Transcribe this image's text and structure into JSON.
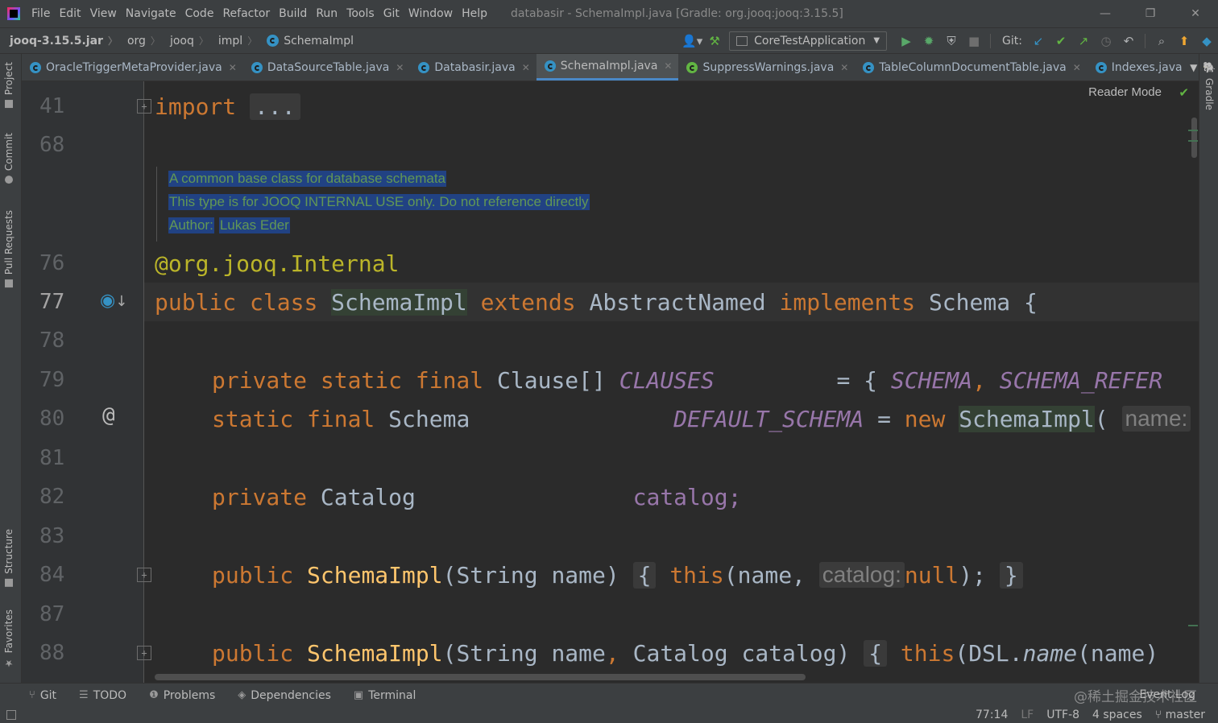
{
  "menubar": {
    "items": [
      "File",
      "Edit",
      "View",
      "Navigate",
      "Code",
      "Refactor",
      "Build",
      "Run",
      "Tools",
      "Git",
      "Window",
      "Help"
    ],
    "window_title": "databasir - SchemaImpl.java [Gradle: org.jooq:jooq:3.15.5]"
  },
  "navbar": {
    "breadcrumbs": [
      "jooq-3.15.5.jar",
      "org",
      "jooq",
      "impl",
      "SchemaImpl"
    ],
    "run_config": "CoreTestApplication",
    "git_label": "Git:"
  },
  "left_tools": [
    "Project",
    "Commit",
    "Pull Requests",
    "Structure",
    "Favorites"
  ],
  "right_tools": [
    "Gradle"
  ],
  "tabs": [
    {
      "label": "OracleTriggerMetaProvider.java",
      "active": false
    },
    {
      "label": "DataSourceTable.java",
      "active": false
    },
    {
      "label": "Databasir.java",
      "active": false
    },
    {
      "label": "SchemaImpl.java",
      "active": true
    },
    {
      "label": "SuppressWarnings.java",
      "active": false
    },
    {
      "label": "TableColumnDocumentTable.java",
      "active": false
    },
    {
      "label": "Indexes.java",
      "active": false
    }
  ],
  "editor": {
    "reader_mode": "Reader Mode",
    "line_numbers": [
      "41",
      "68",
      "76",
      "77",
      "78",
      "79",
      "80",
      "81",
      "82",
      "83",
      "84",
      "87",
      "88"
    ],
    "doc": {
      "line1": "A common base class for database schemata",
      "line2": "This type is for JOOQ INTERNAL USE only. Do not reference directly",
      "author_label": "Author:",
      "author_name": "Lukas Eder"
    },
    "code": {
      "l41_kw": "import",
      "l41_fold": "...",
      "l76": "@org.jooq.Internal",
      "l77_public": "public",
      "l77_class": "class",
      "l77_name": "SchemaImpl",
      "l77_extends": "extends",
      "l77_base": "AbstractNamed",
      "l77_implements": "implements",
      "l77_iface": "Schema {",
      "l79_mods": "private static final",
      "l79_type": "Clause[]",
      "l79_name": "CLAUSES",
      "l79_eq": "= {",
      "l79_v1": "SCHEMA",
      "l79_comma": ",",
      "l79_v2": "SCHEMA_REFER",
      "l80_mods": "static final",
      "l80_type": "Schema",
      "l80_name": "DEFAULT_SCHEMA",
      "l80_eq": "=",
      "l80_new": "new",
      "l80_ctor": "SchemaImpl",
      "l80_paren": "(",
      "l80_hint": "name:",
      "l80_str": "\"\"",
      "l82_mods": "private",
      "l82_type": "Catalog",
      "l82_name": "catalog;",
      "l84_public": "public",
      "l84_ctor": "SchemaImpl",
      "l84_params": "(String name)",
      "l84_open": "{",
      "l84_this": "this",
      "l84_args": "(name,",
      "l84_hint": "catalog:",
      "l84_null": "null",
      "l84_end": ");",
      "l84_close": "}",
      "l88_public": "public",
      "l88_ctor": "SchemaImpl",
      "l88_p1": "(String name",
      "l88_comma": ",",
      "l88_p2": "Catalog catalog)",
      "l88_open": "{",
      "l88_this": "this",
      "l88_call1": "(DSL.",
      "l88_call2": "name",
      "l88_call3": "(name)"
    }
  },
  "bottom_tools": [
    "Git",
    "TODO",
    "Problems",
    "Dependencies",
    "Terminal"
  ],
  "event_log": "Event Log",
  "watermark": "@稀土掘金技术社区",
  "statusbar": {
    "position": "77:14",
    "line_sep": "LF",
    "encoding": "UTF-8",
    "indent": "4 spaces",
    "branch": "master"
  },
  "colors": {
    "keyword": "#cc7832",
    "annotation": "#bbb529",
    "constant": "#9876aa",
    "function": "#ffc66d",
    "doc_highlight": "#214283",
    "active_tab": "#4a88c7"
  }
}
